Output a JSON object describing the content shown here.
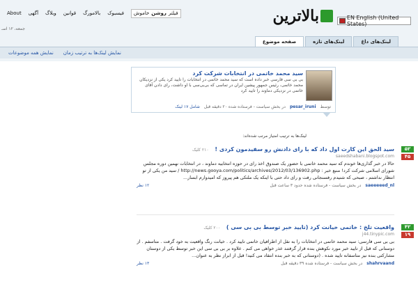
{
  "lang_selector": "EN English (United States)",
  "logo_text": "بالاترین",
  "date": "جمعه، ۱۲ اسـ",
  "top_links": {
    "about": "About",
    "ads": "آگهی",
    "weblog": "وبلاگ",
    "rules": "قوانین",
    "balamorg": "بالامورگ",
    "facebook": "فیسبوک",
    "filter_label": "فیلتر",
    "filter_on": "روشن",
    "filter_off": "خاموش"
  },
  "tabs": [
    {
      "label": "لینک‌های داغ"
    },
    {
      "label": "لینک‌های تازه"
    },
    {
      "label": "صفحه موضوع"
    }
  ],
  "subnav": {
    "by_time": "نمایش لینک‌ها به ترتیب زمان",
    "show_all": "نمایش همه موضوعات"
  },
  "featured": {
    "title": "سید محمد خاتمی در انتخابات شرکت کرد",
    "text": "بی بی سی فارسی خبر داده است که سید محمد خاتمی در انتخابات را تایید کرد یکی از نزدیکان محمد خاتمی، رئیس جمهور پیشین ایران در تماسی که بی‌بی‌سی با او داشت، رای دادن آقای خاتمی در نزدیکی دماوند را تایید کرد",
    "meta_user": "pesar_iruni",
    "meta_section": "توسط",
    "meta_time": "در بخش سیاست - فرستاده شده ۲۰ دقیقه قبل",
    "meta_comments": "شامل ۱۷ لینک"
  },
  "sort_label": "لینک‌ها به ترتیب امتیاز مرتب شده‌اند:",
  "posts": [
    {
      "up": "۵۲",
      "down": "۴۵",
      "title": "سید الحق این کارت اول داد که با رای دادنش رو سفیدمون کردی !",
      "clicks": "۲۱۰ کلیک",
      "source": "saeedshabani.blogspot.com",
      "body": "حالا در خبر گذاری‌ها خوندم که سید محمد خاتمی با حضور یک صندوق اخذ رای در حوزه انتخابیه دماوند ، در انتخابات نهمین دوره مجلس شورای اسلامی شرکت کرد! منبع خبر : http://news.gooya.com/politics/archives/2012/03/136902.php / سید من یکی از تو انتظار نداشتم ، صبحی که شنیدم رفسنجانی رفت و رای داد حتی با اینکه یک ملتکی هم پیروز که امیدوارم ابسار...",
      "user": "saeeeeed_nl",
      "meta": "در بخش سیاست - فرستاده شده حدود ۳ ساعت قبل",
      "comments": "۱۲ نظر"
    },
    {
      "up": "۴۲",
      "down": "۱۹",
      "title": "واقعیت تلخ : خاتمی خیانت کرد (تایید خبر توسط بی بی سی )",
      "clicks": "۲۰۰ کلیک",
      "source": "j44.tinypic.com",
      "body": "بی بی سی فارسی: سید محمد خاتمی در انتخابات را به نقل از اطرافیان خاتمی تایید کرد . خیانت رنگ واقعیت به خود گرفت . متاسفم . از دوستانی که قبل از تایید خبر مورد نکوهش بنده قرار گرفتند عذر خواهی می کنم . علاوه بر بی بی سی این خبر توسط یکی از دوستان مشارکتی بنده نیز متاسفانه تایید شده . (دوستانی که به خبر بنده انتقاد می کنید! قبل از ابراز نظر به عنوان...",
      "user": "shahrvaand",
      "meta": "در بخش سیاست - فرستاده شده ۳۹ دقیقه قبل",
      "comments": "۱۳ نظر"
    }
  ]
}
